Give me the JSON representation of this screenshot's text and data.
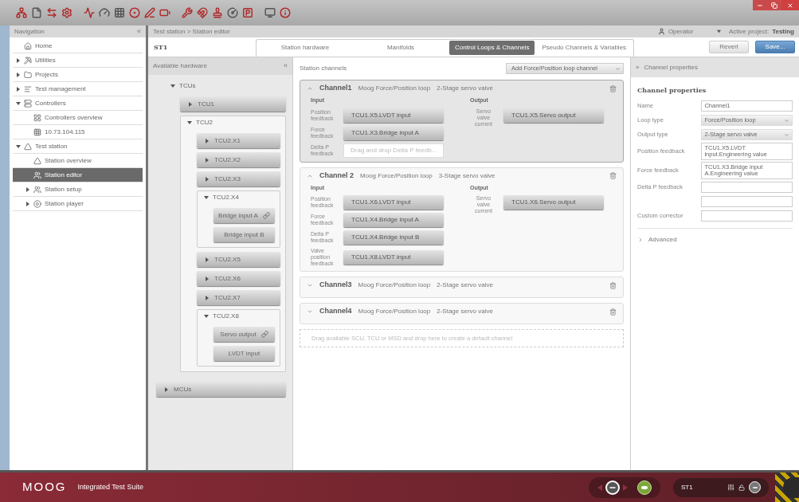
{
  "navigation": {
    "title": "Navigation",
    "collapse": "«",
    "items": [
      {
        "label": "Home",
        "selected": false
      },
      {
        "label": "Utilities",
        "selected": false,
        "expanded": false
      },
      {
        "label": "Projects",
        "selected": false,
        "expanded": false
      },
      {
        "label": "Test management",
        "selected": false,
        "expanded": false
      },
      {
        "label": "Controllers",
        "selected": false,
        "expanded": true,
        "children": [
          {
            "label": "Controllers overview",
            "selected": false
          },
          {
            "label": "10.73.104.115",
            "selected": false
          }
        ]
      },
      {
        "label": "Test station",
        "selected": false,
        "expanded": true,
        "children": [
          {
            "label": "Station overview",
            "selected": false
          },
          {
            "label": "Station editor",
            "selected": true
          },
          {
            "label": "Station setup",
            "selected": false,
            "expanded": false
          },
          {
            "label": "Station player",
            "selected": false,
            "expanded": false
          }
        ]
      }
    ]
  },
  "breadcrumb": "Test station > Station editor",
  "session": {
    "user": "Operator",
    "project_label": "Active project:",
    "project": "Testing"
  },
  "station": "ST1",
  "tabs": [
    {
      "label": "Station hardware",
      "selected": false
    },
    {
      "label": "Manifolds",
      "selected": false
    },
    {
      "label": "Control Loops & Channels",
      "selected": true
    },
    {
      "label": "Pseudo Channels & Variables",
      "selected": false
    }
  ],
  "actions": [
    {
      "label": "Revert",
      "primary": false
    },
    {
      "label": "Save...",
      "primary": true
    }
  ],
  "hardware": {
    "title": "Available hardware",
    "collapse": "«",
    "tree": [
      {
        "label": "TCUs",
        "expanded": true,
        "children": [
          {
            "label": "TCU1",
            "expanded": false
          },
          {
            "label": "TCU2",
            "expanded": true,
            "children": [
              {
                "label": "TCU2.X1",
                "expanded": false
              },
              {
                "label": "TCU2.X2",
                "expanded": false
              },
              {
                "label": "TCU2.X3",
                "expanded": false
              },
              {
                "label": "TCU2.X4",
                "expanded": true,
                "children": [
                  {
                    "label": "Bridge input A",
                    "linked": true
                  },
                  {
                    "label": "Bridge input B",
                    "linked": false
                  }
                ]
              },
              {
                "label": "TCU2.X5",
                "expanded": false
              },
              {
                "label": "TCU2.X6",
                "expanded": false
              },
              {
                "label": "TCU2.X7",
                "expanded": false
              },
              {
                "label": "TCU2.X8",
                "expanded": true,
                "children": [
                  {
                    "label": "Servo output",
                    "linked": true
                  },
                  {
                    "label": "LVDT input",
                    "linked": false
                  }
                ]
              }
            ]
          }
        ]
      },
      {
        "label": "MCUs",
        "expanded": false
      }
    ]
  },
  "channels": {
    "title": "Station channels",
    "add": "Add Force/Position loop channel",
    "list": [
      {
        "name": "Channel1",
        "loop": "Moog Force/Position loop",
        "valve": "2-Stage servo valve",
        "expanded": true,
        "selected": true,
        "input_title": "Input",
        "output_title": "Output",
        "inputs": [
          {
            "label": "Position feedback",
            "value": "TCU1.X5.LVDT input",
            "kind": "assigned"
          },
          {
            "label": "Force feedback",
            "value": "TCU1.X3.Bridge input A",
            "kind": "assigned"
          },
          {
            "label": "Delta P feedback",
            "placeholder": "Drag and drop Delta P feedb...",
            "kind": "empty"
          }
        ],
        "outputs": [
          {
            "label": "Servo valve current",
            "value": "TCU1.X5.Servo output",
            "kind": "assigned"
          }
        ]
      },
      {
        "name": "Channel 2",
        "loop": "Moog Force/Position loop",
        "valve": "3-Stage servo valve",
        "expanded": true,
        "selected": false,
        "input_title": "Input",
        "output_title": "Output",
        "inputs": [
          {
            "label": "Position feedback",
            "value": "TCU1.X6.LVDT input",
            "kind": "assigned"
          },
          {
            "label": "Force feedback",
            "value": "TCU1.X4.Bridge input A",
            "kind": "assigned"
          },
          {
            "label": "Delta P feedback",
            "value": "TCU1.X4.Bridge input B",
            "kind": "assigned"
          },
          {
            "label": "Valve position feedback",
            "value": "TCU1.X8.LVDT input",
            "kind": "assigned"
          }
        ],
        "outputs": [
          {
            "label": "Servo valve current",
            "value": "TCU1.X6.Servo output",
            "kind": "assigned"
          }
        ]
      },
      {
        "name": "Channel3",
        "loop": "Moog Force/Position loop",
        "valve": "2-Stage servo valve",
        "expanded": false,
        "selected": false
      },
      {
        "name": "Channel4",
        "loop": "Moog Force/Position loop",
        "valve": "2-Stage servo valve",
        "expanded": false,
        "selected": false
      }
    ],
    "drop_hint": "Drag available SCU, TCU or MSD and drop here to create a default channel"
  },
  "properties": {
    "header_mark": "»",
    "header": "Channel properties",
    "title": "Channel properties",
    "fields": [
      {
        "label": "Name",
        "value": "Channel1",
        "kind": "text"
      },
      {
        "label": "Loop type",
        "value": "Force/Position loop",
        "kind": "select"
      },
      {
        "label": "Output type",
        "value": "2-Stage servo valve",
        "kind": "select"
      },
      {
        "label": "Position feedback",
        "value": "TCU1.X5.LVDT input.Engineering value",
        "kind": "text"
      },
      {
        "label": "Force feedback",
        "value": "TCU1.X3.Bridge input A.Engineering value",
        "kind": "text"
      },
      {
        "label": "Delta P feedback",
        "kind": "text"
      },
      {
        "kind": "text"
      },
      {
        "label": "Custom corrector",
        "kind": "text"
      }
    ],
    "advanced": {
      "label": "Advanced",
      "expanded": false
    }
  },
  "footer": {
    "brand": "MOOG",
    "product": "Integrated Test Suite",
    "station": "ST1"
  }
}
